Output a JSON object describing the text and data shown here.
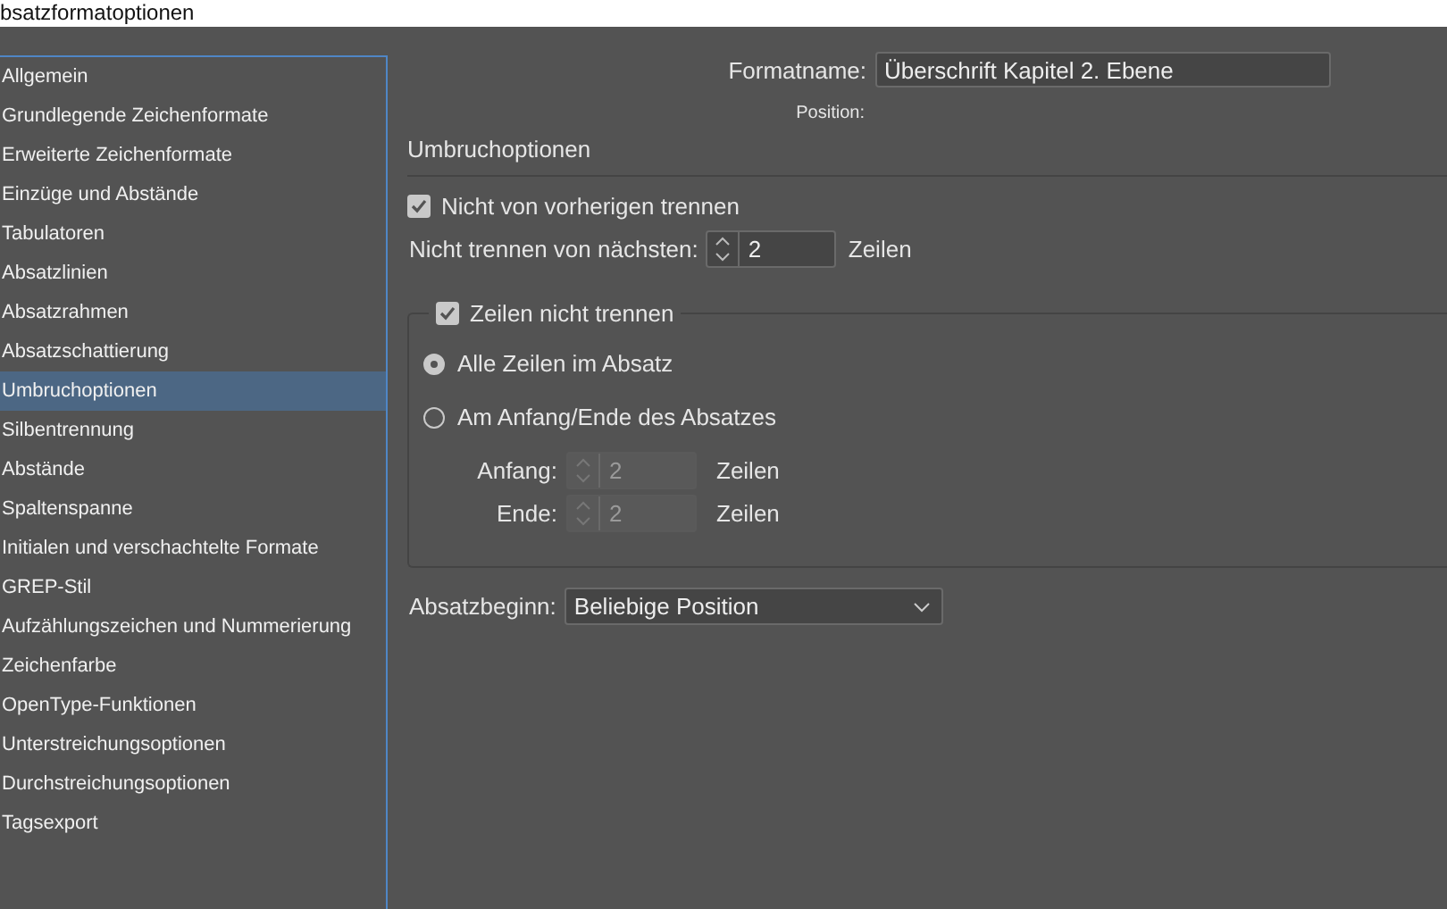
{
  "window": {
    "title": "bsatzformatoptionen"
  },
  "sidebar": {
    "items": [
      {
        "label": "Allgemein",
        "selected": false
      },
      {
        "label": "Grundlegende Zeichenformate",
        "selected": false
      },
      {
        "label": "Erweiterte Zeichenformate",
        "selected": false
      },
      {
        "label": "Einzüge und Abstände",
        "selected": false
      },
      {
        "label": "Tabulatoren",
        "selected": false
      },
      {
        "label": "Absatzlinien",
        "selected": false
      },
      {
        "label": "Absatzrahmen",
        "selected": false
      },
      {
        "label": "Absatzschattierung",
        "selected": false
      },
      {
        "label": "Umbruchoptionen",
        "selected": true
      },
      {
        "label": "Silbentrennung",
        "selected": false
      },
      {
        "label": "Abstände",
        "selected": false
      },
      {
        "label": "Spaltenspanne",
        "selected": false
      },
      {
        "label": "Initialen und verschachtelte Formate",
        "selected": false
      },
      {
        "label": "GREP-Stil",
        "selected": false
      },
      {
        "label": "Aufzählungszeichen und Nummerierung",
        "selected": false
      },
      {
        "label": "Zeichenfarbe",
        "selected": false
      },
      {
        "label": "OpenType-Funktionen",
        "selected": false
      },
      {
        "label": "Unterstreichungsoptionen",
        "selected": false
      },
      {
        "label": "Durchstreichungsoptionen",
        "selected": false
      },
      {
        "label": "Tagsexport",
        "selected": false
      }
    ]
  },
  "format_name": {
    "label": "Formatname:",
    "value": "Überschrift Kapitel 2. Ebene"
  },
  "position_label": "Position:",
  "section_title": "Umbruchoptionen",
  "keep_with_previous": {
    "label": "Nicht von vorherigen trennen",
    "checked": true
  },
  "keep_with_next": {
    "label": "Nicht trennen von nächsten:",
    "value": "2",
    "unit": "Zeilen",
    "disabled": false
  },
  "keep_lines": {
    "label": "Zeilen nicht trennen",
    "checked": true,
    "options": [
      {
        "label": "Alle Zeilen im Absatz",
        "selected": true
      },
      {
        "label": "Am Anfang/Ende des Absatzes",
        "selected": false
      }
    ],
    "fields": [
      {
        "label": "Anfang:",
        "value": "2",
        "unit": "Zeilen",
        "disabled": true
      },
      {
        "label": "Ende:",
        "value": "2",
        "unit": "Zeilen",
        "disabled": true
      }
    ]
  },
  "paragraph_start": {
    "label": "Absatzbeginn:",
    "value": "Beliebige Position"
  }
}
